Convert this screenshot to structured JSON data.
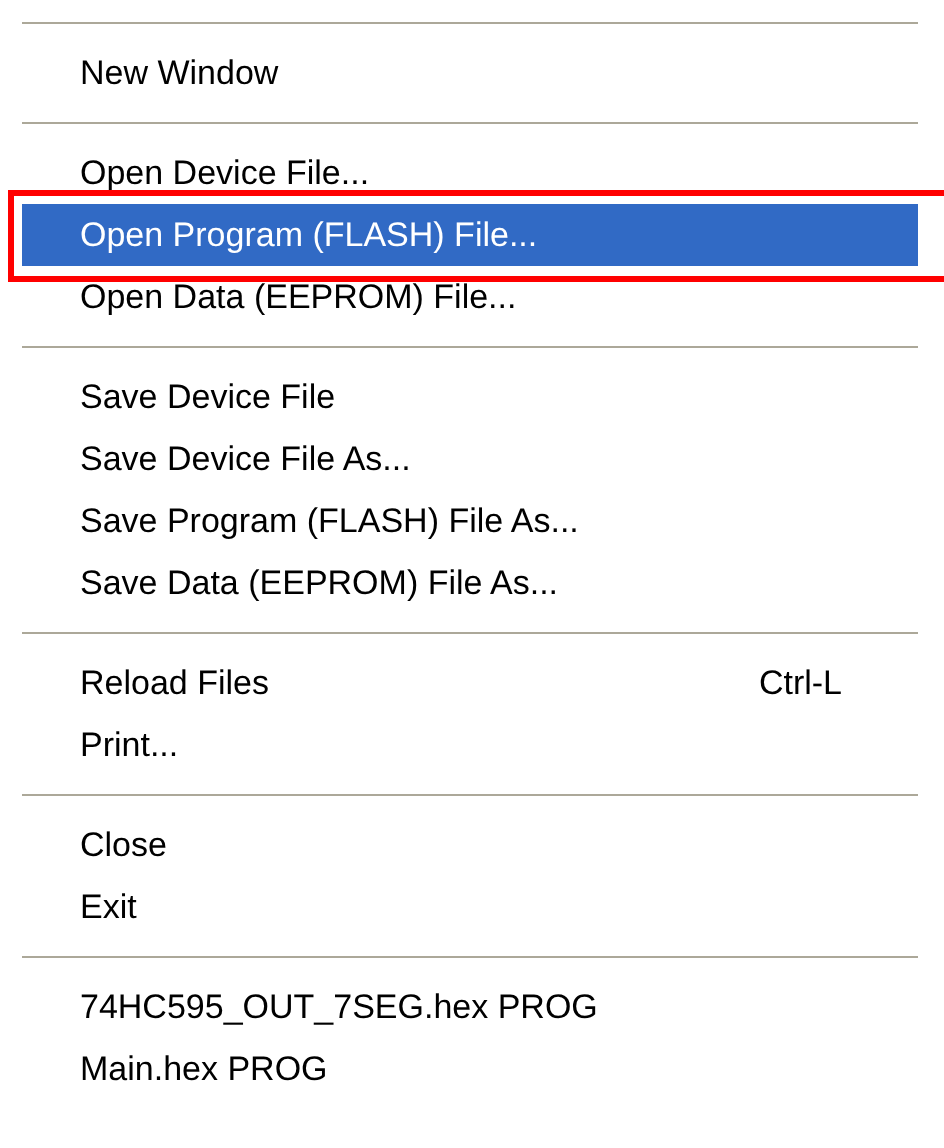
{
  "menu": {
    "groups": [
      {
        "items": [
          {
            "label": "New Window",
            "selected": false,
            "outlined": false
          }
        ]
      },
      {
        "items": [
          {
            "label": "Open Device File...",
            "selected": false,
            "outlined": false
          },
          {
            "label": "Open Program (FLASH) File...",
            "selected": true,
            "outlined": true
          },
          {
            "label": "Open Data (EEPROM) File...",
            "selected": false,
            "outlined": false
          }
        ]
      },
      {
        "items": [
          {
            "label": "Save Device File",
            "selected": false,
            "outlined": false
          },
          {
            "label": "Save Device File As...",
            "selected": false,
            "outlined": false
          },
          {
            "label": "Save Program (FLASH) File As...",
            "selected": false,
            "outlined": false
          },
          {
            "label": "Save Data (EEPROM) File As...",
            "selected": false,
            "outlined": false
          }
        ]
      },
      {
        "items": [
          {
            "label": "Reload Files",
            "shortcut": "Ctrl-L",
            "selected": false,
            "outlined": false
          },
          {
            "label": "Print...",
            "selected": false,
            "outlined": false
          }
        ]
      },
      {
        "items": [
          {
            "label": "Close",
            "selected": false,
            "outlined": false
          },
          {
            "label": "Exit",
            "selected": false,
            "outlined": false
          }
        ]
      },
      {
        "items": [
          {
            "label": "74HC595_OUT_7SEG.hex PROG",
            "selected": false,
            "outlined": false
          },
          {
            "label": "Main.hex PROG",
            "selected": false,
            "outlined": false
          }
        ]
      }
    ]
  }
}
